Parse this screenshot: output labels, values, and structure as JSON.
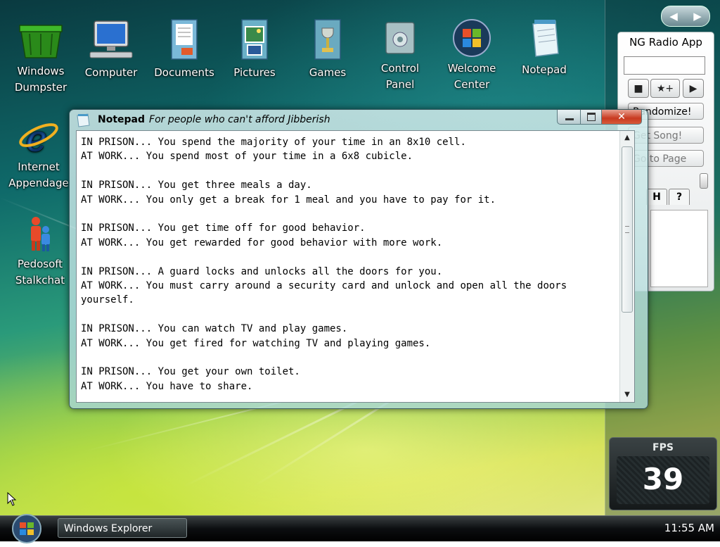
{
  "desktop": {
    "icons": [
      {
        "id": "windows-dumpster",
        "label_line1": "Windows",
        "label_line2": "Dumpster"
      },
      {
        "id": "computer",
        "label_line1": "Computer",
        "label_line2": ""
      },
      {
        "id": "documents",
        "label_line1": "Documents",
        "label_line2": ""
      },
      {
        "id": "pictures",
        "label_line1": "Pictures",
        "label_line2": ""
      },
      {
        "id": "games",
        "label_line1": "Games",
        "label_line2": ""
      },
      {
        "id": "control-panel",
        "label_line1": "Control",
        "label_line2": "Panel"
      },
      {
        "id": "welcome-center",
        "label_line1": "Welcome",
        "label_line2": "Center"
      },
      {
        "id": "notepad",
        "label_line1": "Notepad",
        "label_line2": ""
      },
      {
        "id": "internet-appendage",
        "label_line1": "Internet",
        "label_line2": "Appendage"
      },
      {
        "id": "pedosoft-stalkchat",
        "label_line1": "Pedosoft",
        "label_line2": "Stalkchat"
      }
    ]
  },
  "notepad": {
    "app_name": "Notepad",
    "tagline": "For people who can't afford Jibberish",
    "lines": [
      "IN PRISON... You spend the majority of your time in an 8x10 cell.",
      "AT WORK... You spend most of your time in a 6x8 cubicle.",
      "",
      "IN PRISON... You get three meals a day.",
      "AT WORK... You only get a break for 1 meal and you have to pay for it.",
      "",
      "IN PRISON... You get time off for good behavior.",
      "AT WORK... You get rewarded for good behavior with more work.",
      "",
      "IN PRISON... A guard locks and unlocks all the doors for you.",
      "AT WORK... You must carry around a security card and unlock and open all the doors",
      "yourself.",
      "",
      "IN PRISON... You can watch TV and play games.",
      "AT WORK... You get fired for watching TV and playing games.",
      "",
      "IN PRISON... You get your own toilet.",
      "AT WORK... You have to share."
    ]
  },
  "radio": {
    "title": "NG Radio App",
    "randomize_label": "Randomize!",
    "get_song_label": "Get Song!",
    "go_to_page_label": "Go to Page",
    "tab_h": "H",
    "tab_help": "?"
  },
  "fps": {
    "label": "FPS",
    "value": "39"
  },
  "taskbar": {
    "task_label": "Windows Explorer",
    "clock": "11:55 AM"
  },
  "colors": {
    "close_button": "#c83a20",
    "taskbar": "#0c0e10",
    "accent_green": "#8cc850"
  }
}
